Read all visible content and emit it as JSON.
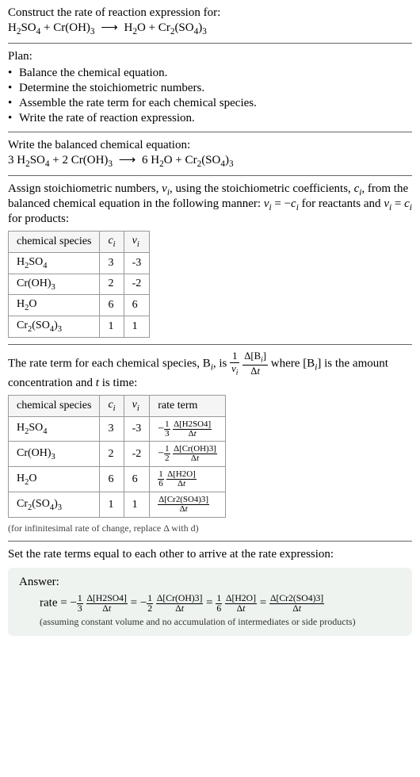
{
  "intro": {
    "prompt": "Construct the rate of reaction expression for:"
  },
  "plan": {
    "heading": "Plan:",
    "items": [
      "Balance the chemical equation.",
      "Determine the stoichiometric numbers.",
      "Assemble the rate term for each chemical species.",
      "Write the rate of reaction expression."
    ]
  },
  "balanced": {
    "heading": "Write the balanced chemical equation:"
  },
  "stoich": {
    "text1": "Assign stoichiometric numbers, ",
    "text2": ", using the stoichiometric coefficients, ",
    "text3": ", from the balanced chemical equation in the following manner: ",
    "text4": " for reactants and ",
    "text5": " for products:",
    "table": {
      "h1": "chemical species",
      "h2": "cᵢ",
      "h3": "νᵢ",
      "rows": [
        {
          "species": "H₂SO₄",
          "c": "3",
          "v": "-3"
        },
        {
          "species": "Cr(OH)₃",
          "c": "2",
          "v": "-2"
        },
        {
          "species": "H₂O",
          "c": "6",
          "v": "6"
        },
        {
          "species": "Cr₂(SO₄)₃",
          "c": "1",
          "v": "1"
        }
      ]
    }
  },
  "rateterm": {
    "text1": "The rate term for each chemical species, B",
    "text2": ", is ",
    "text3": " where [B",
    "text4": "] is the amount concentration and ",
    "text5": " is time:",
    "table": {
      "h1": "chemical species",
      "h2": "cᵢ",
      "h3": "νᵢ",
      "h4": "rate term"
    },
    "note": "(for infinitesimal rate of change, replace Δ with d)"
  },
  "final": {
    "heading": "Set the rate terms equal to each other to arrive at the rate expression:"
  },
  "answer": {
    "label": "Answer:",
    "note": "(assuming constant volume and no accumulation of intermediates or side products)"
  },
  "labels": {
    "rate": "rate",
    "t": "t"
  }
}
